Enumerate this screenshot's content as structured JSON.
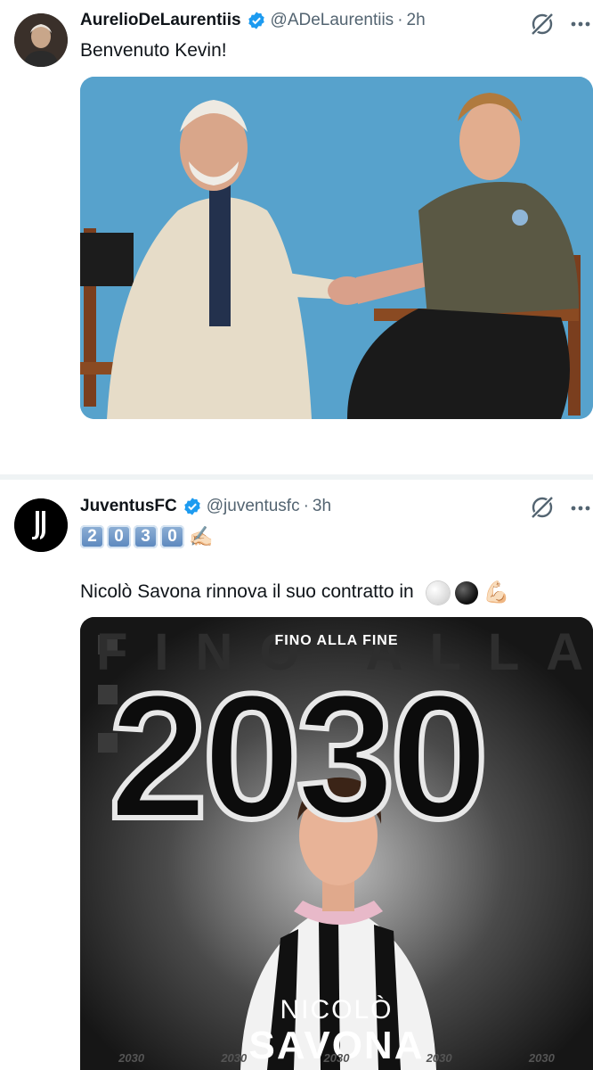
{
  "tweets": [
    {
      "author_name": "AurelioDeLaurentiis",
      "handle": "@ADeLaurentiis",
      "separator": "·",
      "time": "2h",
      "text": "Benvenuto Kevin!",
      "verified_color": "#1d9bf0",
      "media_icon": "photo"
    },
    {
      "author_name": "JuventusFC",
      "handle": "@juventusfc",
      "separator": "·",
      "time": "3h",
      "keycaps": [
        "2",
        "0",
        "3",
        "0"
      ],
      "writing_emoji": "✍🏻",
      "text": "Nicolò Savona rinnova il suo contratto in",
      "flex_emoji": "💪🏻",
      "verified_color": "#1d9bf0",
      "media": {
        "banner_title": "FINO ALLA FINE",
        "ghost_text": "FINO ALLA FINE",
        "year": "2030",
        "first_name": "NICOLÒ",
        "last_name": "SAVONA",
        "strip": [
          "2030",
          "2030",
          "2030",
          "2030",
          "2030"
        ]
      }
    }
  ]
}
